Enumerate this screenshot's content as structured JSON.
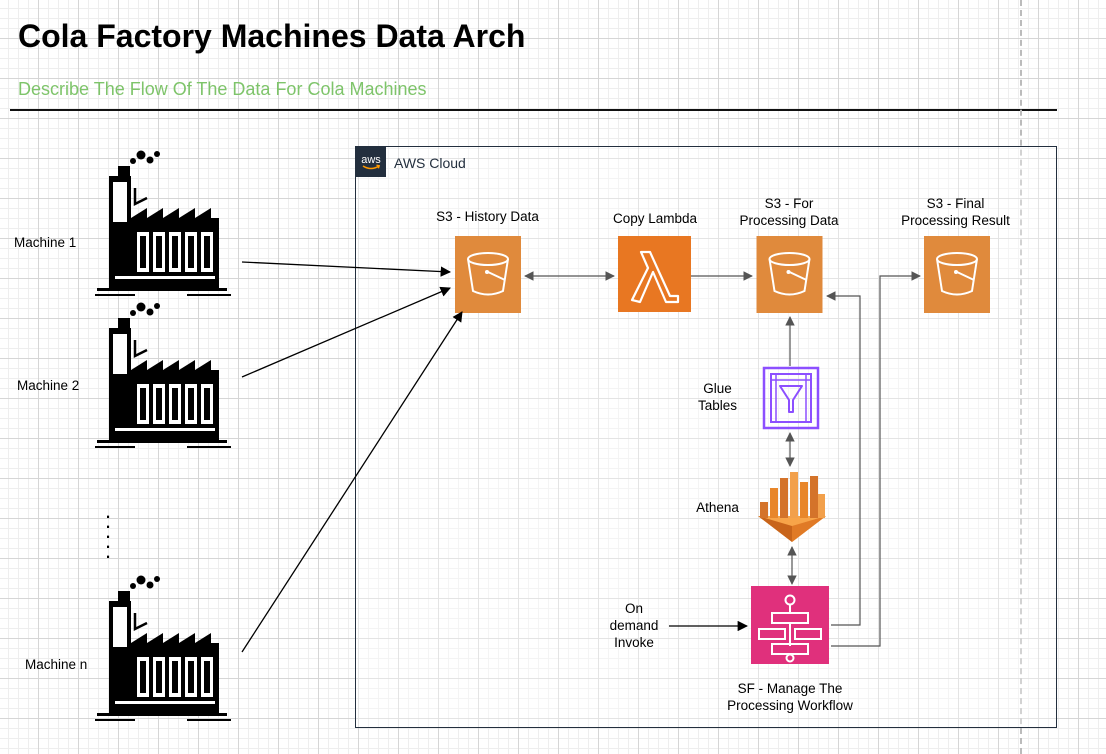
{
  "header": {
    "title": "Cola Factory Machines Data Arch",
    "subtitle": "Describe The Flow Of The Data For Cola Machines"
  },
  "machines": [
    {
      "label": "Machine 1"
    },
    {
      "label": "Machine 2"
    },
    {
      "label": "Machine n"
    }
  ],
  "ellipsis": ".\n.\n.\n.\n.",
  "cloud": {
    "badge": "aws",
    "label": "AWS Cloud"
  },
  "nodes": {
    "s3_history": {
      "label": "S3 - History Data",
      "icon": "s3-bucket-icon"
    },
    "copy_lambda": {
      "label": "Copy Lambda",
      "icon": "lambda-icon"
    },
    "s3_processing": {
      "label": "S3 - For\nProcessing Data",
      "icon": "s3-bucket-icon"
    },
    "s3_final": {
      "label": "S3 - Final\nProcessing Result",
      "icon": "s3-bucket-icon"
    },
    "glue": {
      "label": "Glue\nTables",
      "icon": "glue-data-catalog-icon"
    },
    "athena": {
      "label": "Athena",
      "icon": "athena-icon"
    },
    "step_functions": {
      "label": "SF - Manage The\nProcessing Workflow",
      "icon": "step-functions-icon"
    },
    "invoke": {
      "label": "On\ndemand\nInvoke"
    }
  },
  "colors": {
    "s3": "#e08a3c",
    "lambda": "#e87722",
    "glue": "#8c4fff",
    "athena": "#e8862a",
    "step_functions": "#e0307c",
    "subtitle": "#7ec46a",
    "aws_dark": "#232f3e"
  }
}
